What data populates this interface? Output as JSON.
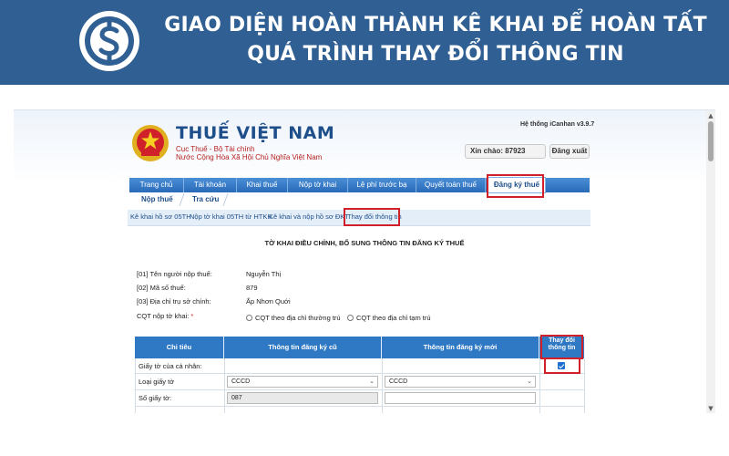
{
  "banner": {
    "title_line1": "GIAO DIỆN HOÀN THÀNH KÊ KHAI ĐỂ HOÀN TẤT",
    "title_line2": "QUÁ TRÌNH THAY ĐỔI THÔNG TIN",
    "logo_icon": "dollar-coin-icon"
  },
  "header": {
    "brand_name": "THUẾ VIỆT NAM",
    "brand_sub1": "Cục Thuế - Bộ Tài chính",
    "brand_sub2": "Nước Cộng Hòa Xã Hội Chủ Nghĩa Việt Nam",
    "system_version": "Hệ thống iCanhan v3.9.7",
    "greeting": "Xin chào: 87923",
    "logout_label": "Đăng xuất"
  },
  "nav": {
    "items": [
      "Trang chủ",
      "Tài khoản",
      "Khai thuế",
      "Nộp tờ khai",
      "Lệ phí trước bạ",
      "Quyết toán thuế",
      "Đăng ký thuế"
    ],
    "active": "Đăng ký thuế",
    "subnav": [
      "Nộp thuế",
      "Tra cứu"
    ]
  },
  "breadcrumbs": [
    "Kê khai hồ sơ 05TH",
    "Nộp tờ khai 05TH từ HTKK",
    "Kê khai và nộp hồ sơ ĐKT",
    "Thay đổi thông tin"
  ],
  "form": {
    "title": "TỜ KHAI ĐIỀU CHỈNH, BỔ SUNG THÔNG TIN ĐĂNG KÝ THUẾ",
    "fields": [
      {
        "label": "[01] Tên người nộp thuế:",
        "value": "Nguyễn Thị"
      },
      {
        "label": "[02] Mã số thuế:",
        "value": "879"
      },
      {
        "label": "[03] Địa chỉ trụ sở chính:",
        "value": "Ấp Nhơn Quới"
      }
    ],
    "cqt_label": "CQT nộp tờ khai:",
    "cqt_required": "*",
    "cqt_options": [
      "CQT theo địa chỉ thường trú",
      "CQT theo địa chỉ tạm trú"
    ]
  },
  "table": {
    "headers": [
      "Chỉ tiêu",
      "Thông tin đăng ký cũ",
      "Thông tin đăng ký mới"
    ],
    "change_header_line1": "Thay đổi",
    "change_header_line2": "thông tin",
    "rows": [
      {
        "label": "Giấy tờ của cá nhân:",
        "old": "",
        "new": "",
        "checked": true
      },
      {
        "label": "Loại giấy tờ",
        "old": "CCCD",
        "new": "CCCD"
      },
      {
        "label": "Số giấy tờ:",
        "old": "087",
        "new": ""
      }
    ]
  },
  "colors": {
    "banner_bg": "#2f5f93",
    "nav_blue": "#2a6ab8",
    "highlight_red": "#d0202a"
  }
}
